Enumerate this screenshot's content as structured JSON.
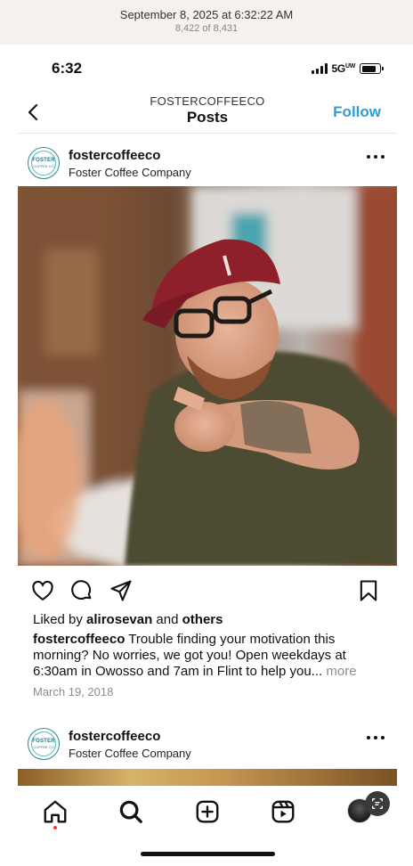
{
  "viewer": {
    "date": "September 8, 2025 at 6:32:22 AM",
    "count": "8,422 of 8,431"
  },
  "status_bar": {
    "time": "6:32",
    "network": "5G",
    "network_suffix": "UW",
    "battery_level": 0.8
  },
  "nav": {
    "account": "FOSTERCOFFEECO",
    "title": "Posts",
    "follow_label": "Follow"
  },
  "posts": [
    {
      "username": "fostercoffeeco",
      "subtitle": "Foster Coffee Company",
      "avatar_text": "FOSTER",
      "avatar_sub": "COFFEE CO",
      "liked_by_prefix": "Liked by ",
      "liked_by_user": "alirosevan",
      "liked_by_and": " and ",
      "liked_by_others": "others",
      "caption_user": "fostercoffeeco",
      "caption_text": " Trouble finding your motivation this morning? No worries, we got you! Open weekdays at 6:30am in Owosso and 7am in Flint to help you...",
      "caption_more": " more",
      "date": "March 19, 2018"
    },
    {
      "username": "fostercoffeeco",
      "subtitle": "Foster Coffee Company",
      "avatar_text": "FOSTER",
      "avatar_sub": "COFFEE CO"
    }
  ],
  "icons": {
    "back": "chevron-left-icon",
    "more": "more-horizontal-icon",
    "like": "heart-icon",
    "comment": "comment-icon",
    "share": "send-icon",
    "save": "bookmark-icon",
    "home": "home-icon",
    "search": "search-icon",
    "create": "plus-square-icon",
    "reels": "reels-icon",
    "live_text": "live-text-icon"
  },
  "colors": {
    "follow": "#2d9cdb",
    "notification_dot": "#ff3040",
    "brand_teal": "#2a8a8f"
  }
}
